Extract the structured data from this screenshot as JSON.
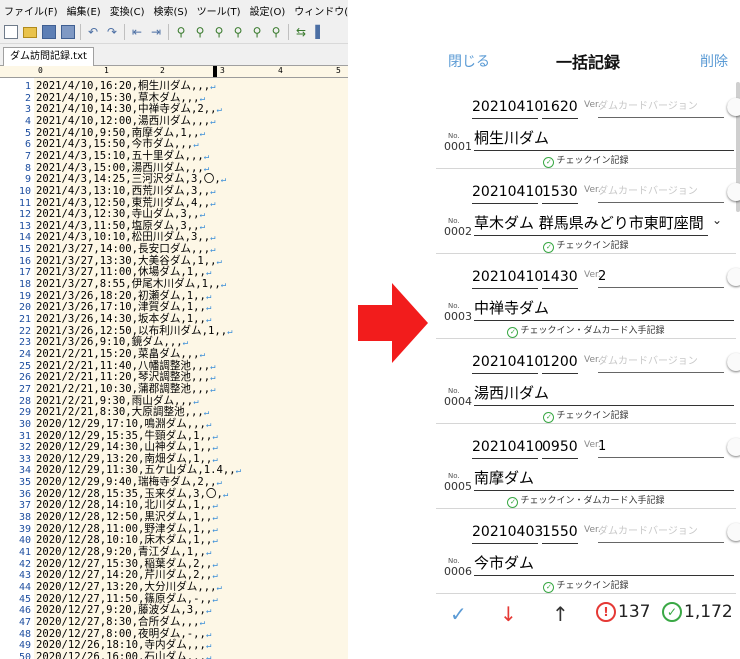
{
  "editor": {
    "menu": [
      "ファイル(F)",
      "編集(E)",
      "変換(C)",
      "検索(S)",
      "ツール(T)",
      "設定(O)",
      "ウィンドウ(W)"
    ],
    "tab_title": "ダム訪問記録.txt",
    "ruler_ticks": [
      "0",
      "1",
      "2",
      "3",
      "4",
      "5"
    ],
    "lines": [
      "2021/4/10,16:20,桐生川ダム,,,",
      "2021/4/10,15:30,草木ダム,,,",
      "2021/4/10,14:30,中禅寺ダム,2,,",
      "2021/4/10,12:00,湯西川ダム,,,",
      "2021/4/10,9:50,南摩ダム,1,,",
      "2021/4/3,15:50,今市ダム,,,",
      "2021/4/3,15:10,五十里ダム,,,",
      "2021/4/3,15:00,湯西川ダム,,,",
      "2021/4/3,14:25,三河沢ダム,3,〇,",
      "2021/4/3,13:10,西荒川ダム,3,,",
      "2021/4/3,12:50,東荒川ダム,4,,",
      "2021/4/3,12:30,寺山ダム,3,,",
      "2021/4/3,11:50,塩原ダム,3,,",
      "2021/4/3,10:10,松田川ダム,3,,",
      "2021/3/27,14:00,長安口ダム,,,",
      "2021/3/27,13:30,大美谷ダム,1,,",
      "2021/3/27,11:00,休場ダム,1,,",
      "2021/3/27,8:55,伊尾木川ダム,1,,",
      "2021/3/26,18:20,初瀬ダム,1,,",
      "2021/3/26,17:10,津賀ダム,1,,",
      "2021/3/26,14:30,坂本ダム,1,,",
      "2021/3/26,12:50,以布利川ダム,1,,",
      "2021/3/26,9:10,鏡ダム,,,",
      "2021/2/21,15:20,菜畠ダム,,,",
      "2021/2/21,11:40,八幡調整池,,,",
      "2021/2/21,11:20,琴沢調整池,,,",
      "2021/2/21,10:30,蒲郡調整池,,,",
      "2021/2/21,9:30,雨山ダム,,,",
      "2021/2/21,8:30,大原調整池,,,",
      "2020/12/29,17:10,鳴淵ダム,,,",
      "2020/12/29,15:35,牛頸ダム,1,,",
      "2020/12/29,14:30,山神ダム,1,,",
      "2020/12/29,13:20,南畑ダム,1,,",
      "2020/12/29,11:30,五ケ山ダム,1.4,,",
      "2020/12/29,9:40,瑞梅寺ダム,2,,",
      "2020/12/28,15:35,玉来ダム,3,〇,",
      "2020/12/28,14:10,北川ダム,1,,",
      "2020/12/28,12:50,黒沢ダム,1,,",
      "2020/12/28,11:00,野津ダム,1,,",
      "2020/12/28,10:10,床木ダム,1,,",
      "2020/12/28,9:20,青江ダム,1,,",
      "2020/12/27,15:30,稲葉ダム,2,,",
      "2020/12/27,14:20,芹川ダム,2,,",
      "2020/12/27,13:20,大分川ダム,,,",
      "2020/12/27,11:50,篠原ダム,-,,",
      "2020/12/27,9:20,藤波ダム,3,,",
      "2020/12/27,8:30,合所ダム,,,",
      "2020/12/27,8:00,夜明ダム,-,,",
      "2020/12/26,18:10,寺内ダム,,,",
      "2020/12/26,16:00,石山ダム,,,"
    ]
  },
  "app": {
    "close_label": "閉じる",
    "title": "一括記録",
    "delete_label": "削除",
    "no_label": "No.",
    "ver_label": "Ver.",
    "ver_placeholder": "ダムカードバージョン",
    "records": [
      {
        "no": "0001",
        "date": "20210410",
        "time": "1620",
        "ver": "",
        "name": "桐生川ダム",
        "status": "チェックイン記録",
        "dropdown": false
      },
      {
        "no": "0002",
        "date": "20210410",
        "time": "1530",
        "ver": "",
        "name": "草木ダム 群馬県みどり市東町座間",
        "status": "チェックイン記録",
        "dropdown": true
      },
      {
        "no": "0003",
        "date": "20210410",
        "time": "1430",
        "ver": "2",
        "name": "中禅寺ダム",
        "status": "チェックイン・ダムカード入手記録",
        "dropdown": false
      },
      {
        "no": "0004",
        "date": "20210410",
        "time": "1200",
        "ver": "",
        "name": "湯西川ダム",
        "status": "チェックイン記録",
        "dropdown": false
      },
      {
        "no": "0005",
        "date": "20210410",
        "time": "0950",
        "ver": "1",
        "name": "南摩ダム",
        "status": "チェックイン・ダムカード入手記録",
        "dropdown": false
      },
      {
        "no": "0006",
        "date": "20210403",
        "time": "1550",
        "ver": "",
        "name": "今市ダム",
        "status": "チェックイン記録",
        "dropdown": false
      }
    ],
    "footer": {
      "check_icon": "✓",
      "down_icon": "↓",
      "up_icon": "↑",
      "warn_glyph": "!",
      "warn_count": "137",
      "ok_glyph": "✓",
      "ok_count": "1,172"
    },
    "colors": {
      "link": "#5b9bd5",
      "red": "#e53935",
      "green": "#3aa845"
    }
  }
}
